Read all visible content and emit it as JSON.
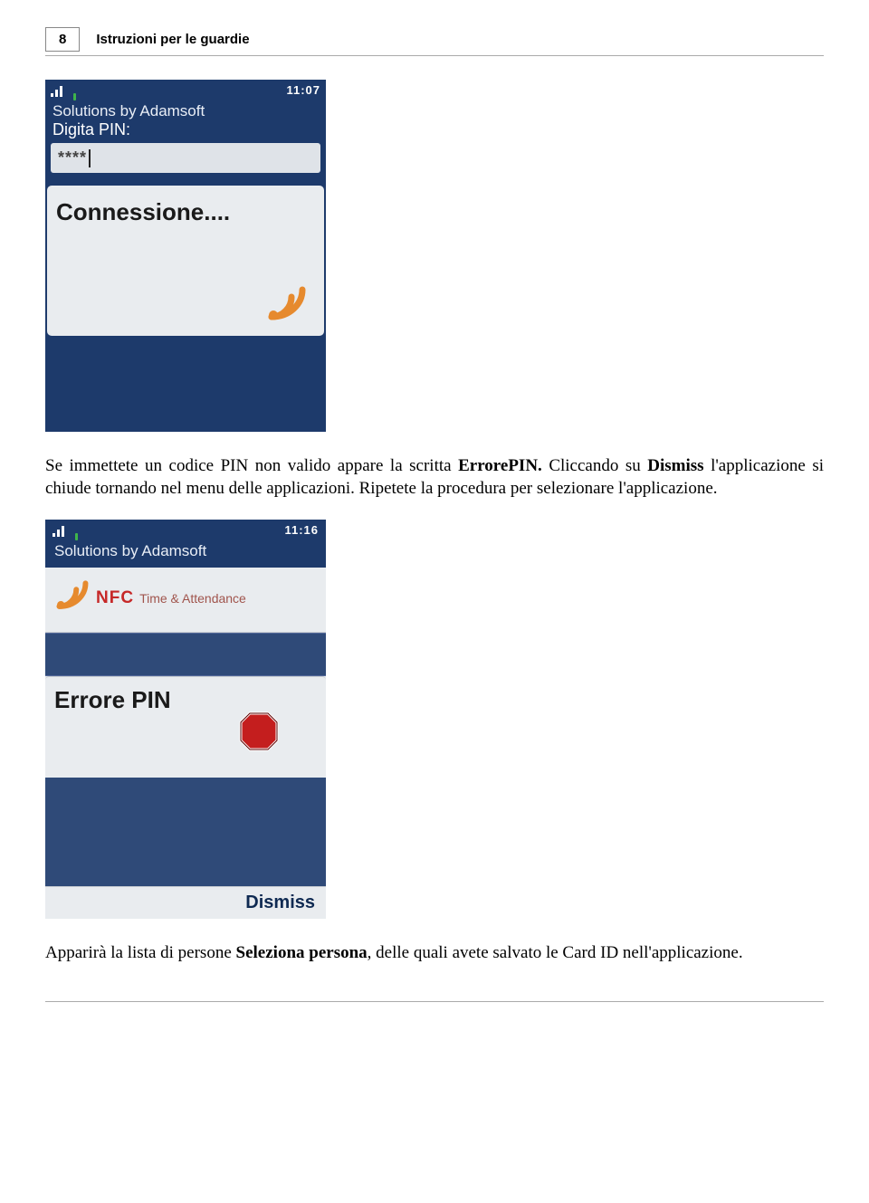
{
  "header": {
    "page_number": "8",
    "title": "Istruzioni per le guardie"
  },
  "phone1": {
    "clock": "11:07",
    "app_title": "Solutions by Adamsoft",
    "pin_label": "Digita PIN:",
    "pin_value": "****",
    "connection_label": "Connessione...."
  },
  "paragraphs": {
    "p1_a": "Se immettete un codice PIN non valido appare la scritta ",
    "p1_b": "ErrorePIN.",
    "p1_c": " Cliccando su ",
    "p1_d": "Dismiss",
    "p1_e": " l'applicazione si chiude tornando nel menu delle applicazioni. Ripetete la procedura per selezionare l'applicazione.",
    "p2_a": "Apparirà la lista di persone ",
    "p2_b": "Seleziona persona",
    "p2_c": ", delle quali avete salvato le Card ID nell'applicazione."
  },
  "phone2": {
    "clock": "11:16",
    "app_title": "Solutions by Adamsoft",
    "nfc_brand": "NFC",
    "nfc_sub": "Time & Attendance",
    "error_label": "Errore PIN",
    "dismiss_label": "Dismiss"
  }
}
